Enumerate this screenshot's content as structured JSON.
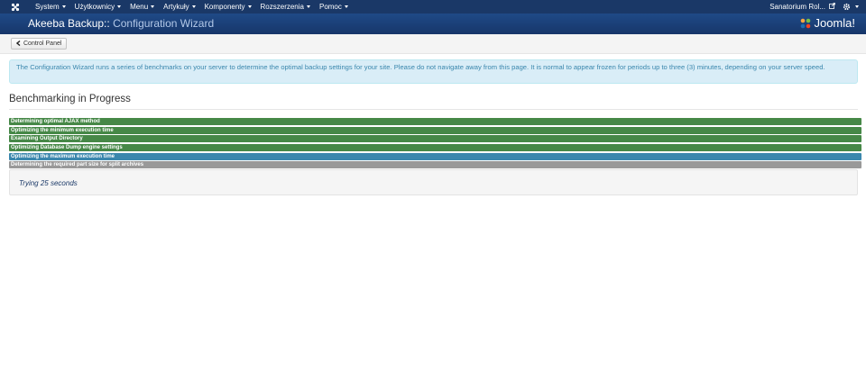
{
  "topnav": {
    "logo_icon": "joomla-icon",
    "menu": [
      {
        "label": "System"
      },
      {
        "label": "Użytkownicy"
      },
      {
        "label": "Menu"
      },
      {
        "label": "Artykuły"
      },
      {
        "label": "Komponenty"
      },
      {
        "label": "Rozszerzenia"
      },
      {
        "label": "Pomoc"
      }
    ],
    "user_label": "Sanatorium Rol...",
    "external_icon": "external-link-icon",
    "settings_icon": "gear-icon"
  },
  "header": {
    "title_main": "Akeeba Backup::",
    "title_sub": " Configuration Wizard",
    "brand": "Joomla!"
  },
  "toolbar": {
    "back_label": "Control Panel",
    "back_icon": "chevron-left-icon"
  },
  "alert": {
    "text": "The Configuration Wizard runs a series of benchmarks on your server to determine the optimal backup settings for your site. Please do not navigate away from this page. It is normal to appear frozen for periods up to three (3) minutes, depending on your server speed."
  },
  "main": {
    "heading": "Benchmarking in Progress",
    "steps": [
      {
        "label": "Determining optimal AJAX method",
        "status": "done"
      },
      {
        "label": "Optimizing the minimum execution time",
        "status": "done"
      },
      {
        "label": "Examining Output Directory",
        "status": "done"
      },
      {
        "label": "Optimizing Database Dump engine settings",
        "status": "done"
      },
      {
        "label": "Optimizing the maximum execution time",
        "status": "active"
      },
      {
        "label": "Determining the required part size for split archives",
        "status": "pending"
      }
    ],
    "status_message": "Trying 25 seconds"
  },
  "colors": {
    "done": "#468847",
    "active": "#3a87ad",
    "pending": "#999999",
    "nav": "#1a3867"
  }
}
